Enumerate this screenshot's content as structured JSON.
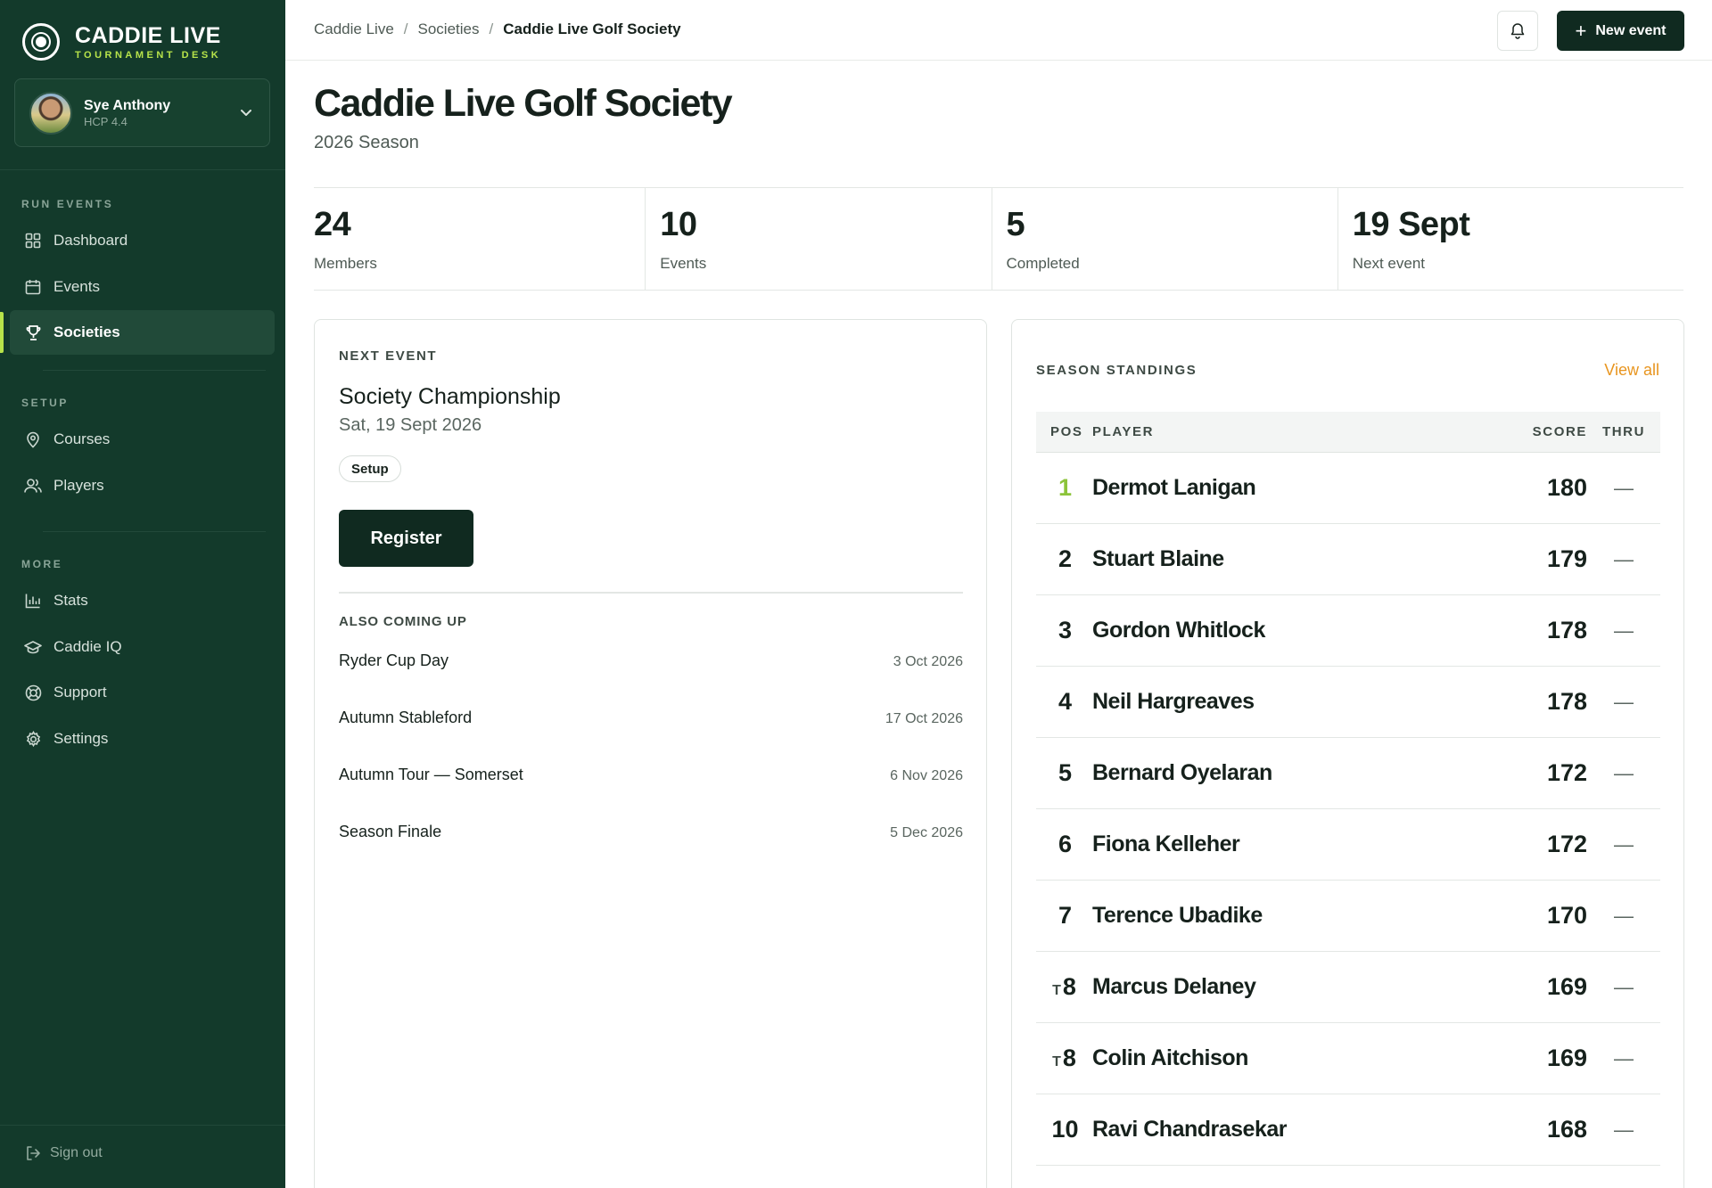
{
  "brand": {
    "name": "CADDIE LIVE",
    "tagline": "TOURNAMENT DESK"
  },
  "user": {
    "name": "Sye Anthony",
    "handicap": "HCP 4.4"
  },
  "sidebar": {
    "sections": [
      {
        "label": "RUN EVENTS"
      },
      {
        "label": "SETUP"
      },
      {
        "label": "MORE"
      }
    ],
    "items": [
      {
        "label": "Dashboard",
        "icon": "grid-icon"
      },
      {
        "label": "Events",
        "icon": "calendar-icon"
      },
      {
        "label": "Societies",
        "icon": "trophy-icon",
        "active": true
      },
      {
        "label": "Courses",
        "icon": "map-pin-icon"
      },
      {
        "label": "Players",
        "icon": "users-icon"
      },
      {
        "label": "Stats",
        "icon": "bar-chart-icon"
      },
      {
        "label": "Caddie IQ",
        "icon": "graduation-cap-icon"
      },
      {
        "label": "Support",
        "icon": "lifebuoy-icon"
      },
      {
        "label": "Settings",
        "icon": "gear-icon"
      }
    ],
    "signout_label": "Sign out"
  },
  "topbar": {
    "breadcrumb": [
      "Caddie Live",
      "Societies",
      "Caddie Live Golf Society"
    ],
    "new_event_label": "New event"
  },
  "page": {
    "title": "Caddie Live Golf Society",
    "subtitle": "2026 Season"
  },
  "stats": [
    {
      "value": "24",
      "label": "Members"
    },
    {
      "value": "10",
      "label": "Events"
    },
    {
      "value": "5",
      "label": "Completed"
    },
    {
      "value": "19 Sept",
      "label": "Next event"
    }
  ],
  "next_event": {
    "eyebrow": "NEXT EVENT",
    "name": "Society Championship",
    "date": "Sat, 19 Sept 2026",
    "status": "Setup",
    "register_label": "Register",
    "also_label": "ALSO COMING UP",
    "upcoming": [
      {
        "name": "Ryder Cup Day",
        "date": "3 Oct 2026"
      },
      {
        "name": "Autumn Stableford",
        "date": "17 Oct 2026"
      },
      {
        "name": "Autumn Tour — Somerset",
        "date": "6 Nov 2026"
      },
      {
        "name": "Season Finale",
        "date": "5 Dec 2026"
      }
    ]
  },
  "standings": {
    "eyebrow": "SEASON STANDINGS",
    "view_all": "View all",
    "headers": {
      "pos": "POS",
      "player": "PLAYER",
      "score": "SCORE",
      "thru": "THRU"
    },
    "rows": [
      {
        "tie": "",
        "pos": "1",
        "player": "Dermot Lanigan",
        "score": "180",
        "thru": "—"
      },
      {
        "tie": "",
        "pos": "2",
        "player": "Stuart Blaine",
        "score": "179",
        "thru": "—"
      },
      {
        "tie": "",
        "pos": "3",
        "player": "Gordon Whitlock",
        "score": "178",
        "thru": "—"
      },
      {
        "tie": "",
        "pos": "4",
        "player": "Neil Hargreaves",
        "score": "178",
        "thru": "—"
      },
      {
        "tie": "",
        "pos": "5",
        "player": "Bernard Oyelaran",
        "score": "172",
        "thru": "—"
      },
      {
        "tie": "",
        "pos": "6",
        "player": "Fiona Kelleher",
        "score": "172",
        "thru": "—"
      },
      {
        "tie": "",
        "pos": "7",
        "player": "Terence Ubadike",
        "score": "170",
        "thru": "—"
      },
      {
        "tie": "T",
        "pos": "8",
        "player": "Marcus Delaney",
        "score": "169",
        "thru": "—"
      },
      {
        "tie": "T",
        "pos": "8",
        "player": "Colin Aitchison",
        "score": "169",
        "thru": "—"
      },
      {
        "tie": "",
        "pos": "10",
        "player": "Ravi Chandrasekar",
        "score": "168",
        "thru": "—"
      }
    ]
  },
  "colors": {
    "sidebar_bg": "#133a2b",
    "accent": "#b7e34a",
    "link": "#e8951f",
    "leader": "#8cc43a",
    "button": "#102a20"
  }
}
